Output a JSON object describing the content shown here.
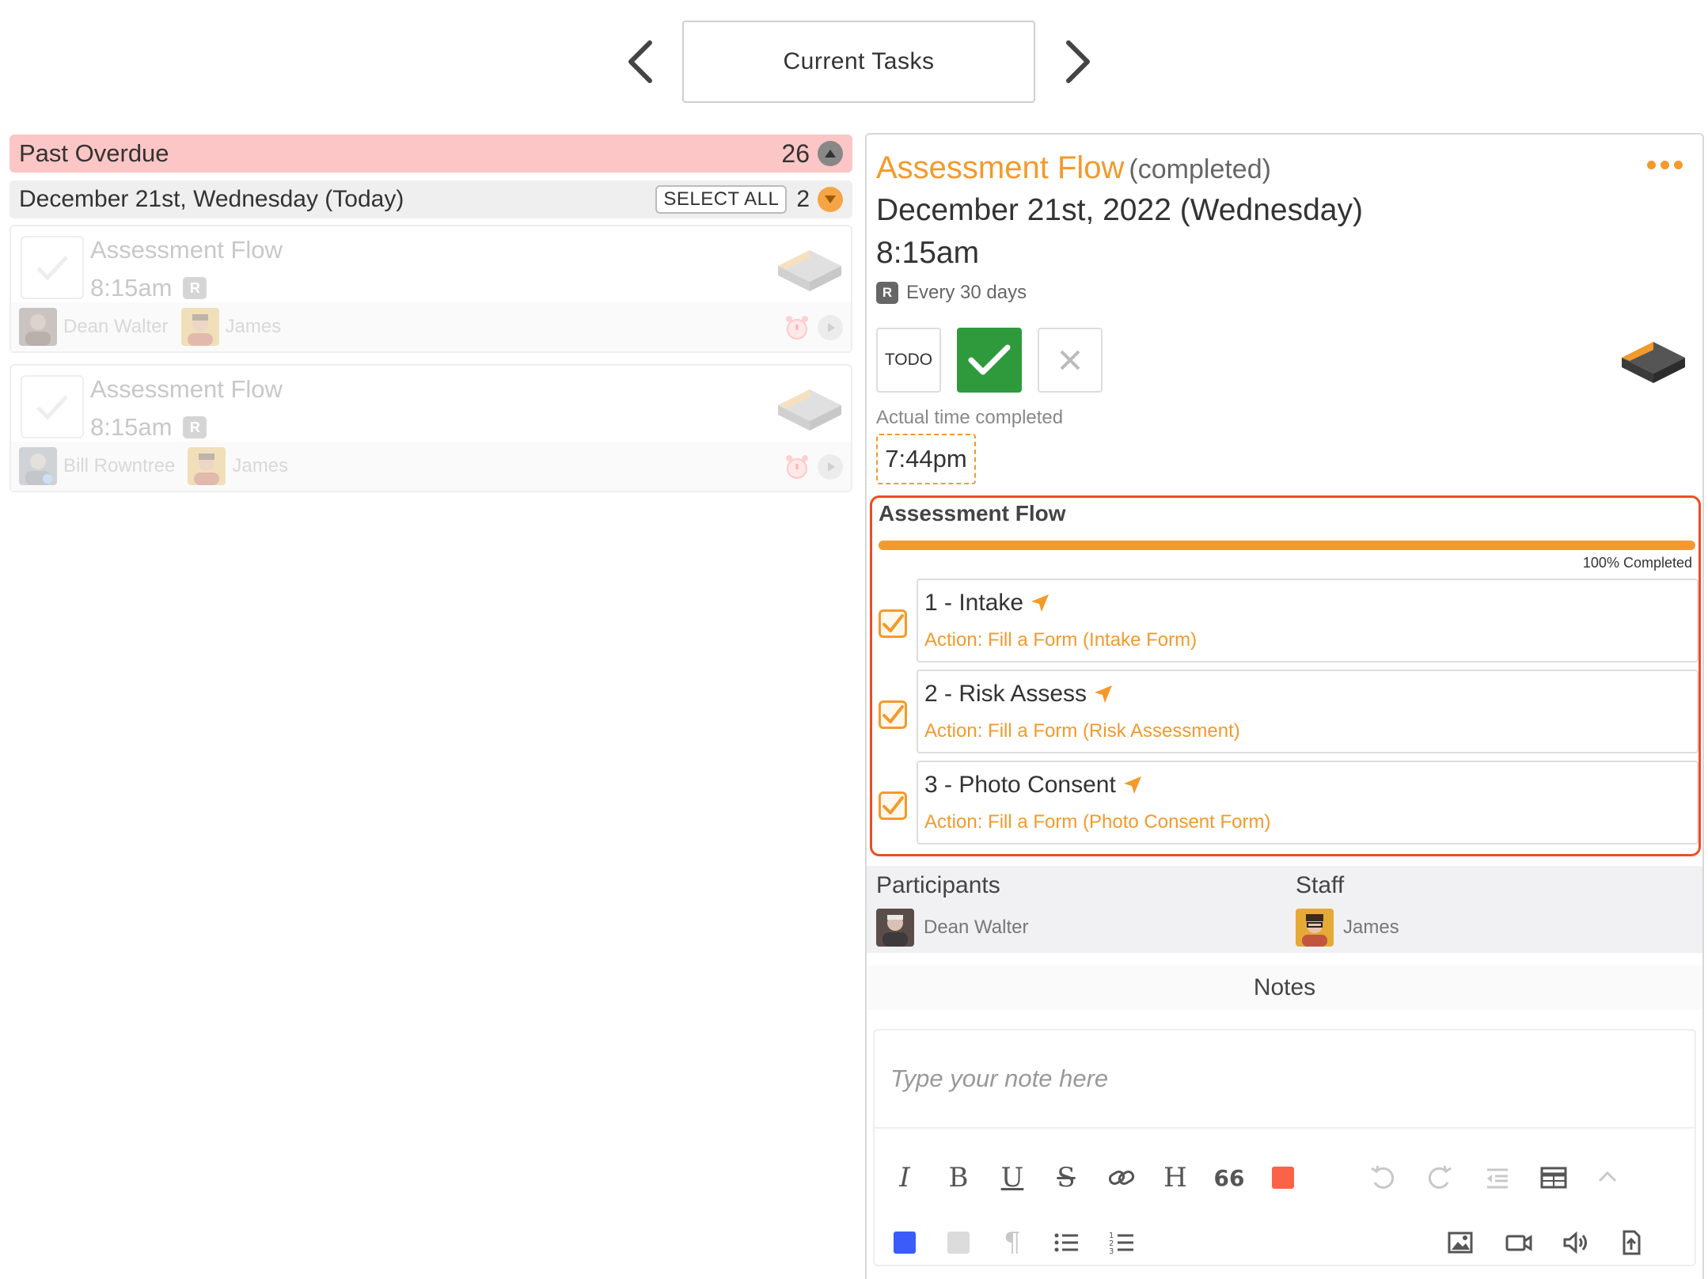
{
  "nav": {
    "title": "Current Tasks"
  },
  "left": {
    "overdue": {
      "label": "Past Overdue",
      "count": "26"
    },
    "today": {
      "label": "December 21st, Wednesday (Today)",
      "select_all": "SELECT ALL",
      "count": "2"
    },
    "tasks": [
      {
        "title": "Assessment Flow",
        "time": "8:15am",
        "badge": "R",
        "participant": "Dean Walter",
        "staff": "James"
      },
      {
        "title": "Assessment Flow",
        "time": "8:15am",
        "badge": "R",
        "participant": "Bill Rowntree",
        "staff": "James"
      }
    ]
  },
  "detail": {
    "title": "Assessment Flow",
    "status": "(completed)",
    "date": "December 21st, 2022 (Wednesday)",
    "time": "8:15am",
    "recurrence_badge": "R",
    "recurrence": "Every 30 days",
    "todo_label": "TODO",
    "actual_label": "Actual time completed",
    "actual_time": "7:44pm",
    "flow": {
      "title": "Assessment Flow",
      "progress_percent": 100,
      "progress_label": "100% Completed",
      "steps": [
        {
          "title": "1 - Intake",
          "action": "Action: Fill a Form (Intake Form)",
          "done": true
        },
        {
          "title": "2 - Risk Assess",
          "action": "Action: Fill a Form (Risk Assessment)",
          "done": true
        },
        {
          "title": "3 - Photo Consent",
          "action": "Action: Fill a Form (Photo Consent Form)",
          "done": true
        }
      ]
    },
    "participants_label": "Participants",
    "participant": "Dean Walter",
    "staff_label": "Staff",
    "staff": "James",
    "notes_label": "Notes",
    "note_placeholder": "Type your note here"
  },
  "colors": {
    "accent": "#f39a2b",
    "success": "#2f9a3c",
    "overdue_bg": "#fbc6c5",
    "highlight": "#ee4d22"
  }
}
